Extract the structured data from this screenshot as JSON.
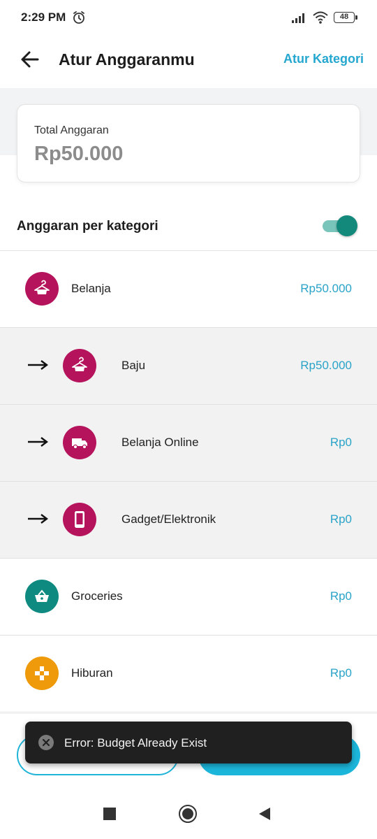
{
  "status": {
    "time": "2:29 PM",
    "battery": "48"
  },
  "header": {
    "title": "Atur Anggaranmu",
    "action": "Atur Kategori"
  },
  "total": {
    "label": "Total Anggaran",
    "value": "Rp50.000"
  },
  "per_category": {
    "label": "Anggaran per kategori",
    "enabled": true
  },
  "categories": [
    {
      "name": "Belanja",
      "amount": "Rp50.000",
      "icon": "hanger-icon",
      "color": "#b5135c",
      "sub": false
    },
    {
      "name": "Baju",
      "amount": "Rp50.000",
      "icon": "hanger-icon",
      "color": "#b5135c",
      "sub": true
    },
    {
      "name": "Belanja Online",
      "amount": "Rp0",
      "icon": "truck-icon",
      "color": "#b5135c",
      "sub": true
    },
    {
      "name": "Gadget/Elektronik",
      "amount": "Rp0",
      "icon": "phone-icon",
      "color": "#b5135c",
      "sub": true
    },
    {
      "name": "Groceries",
      "amount": "Rp0",
      "icon": "basket-icon",
      "color": "#0f8a80",
      "sub": false
    },
    {
      "name": "Hiburan",
      "amount": "Rp0",
      "icon": "gamepad-icon",
      "color": "#ee9a0a",
      "sub": false
    }
  ],
  "toast": {
    "message": "Error: Budget Already Exist",
    "icon": "close-circle-icon"
  },
  "colors": {
    "accent": "#25a7d0",
    "teal": "#12897b",
    "magenta": "#b5135c",
    "orange": "#ee9a0a"
  }
}
